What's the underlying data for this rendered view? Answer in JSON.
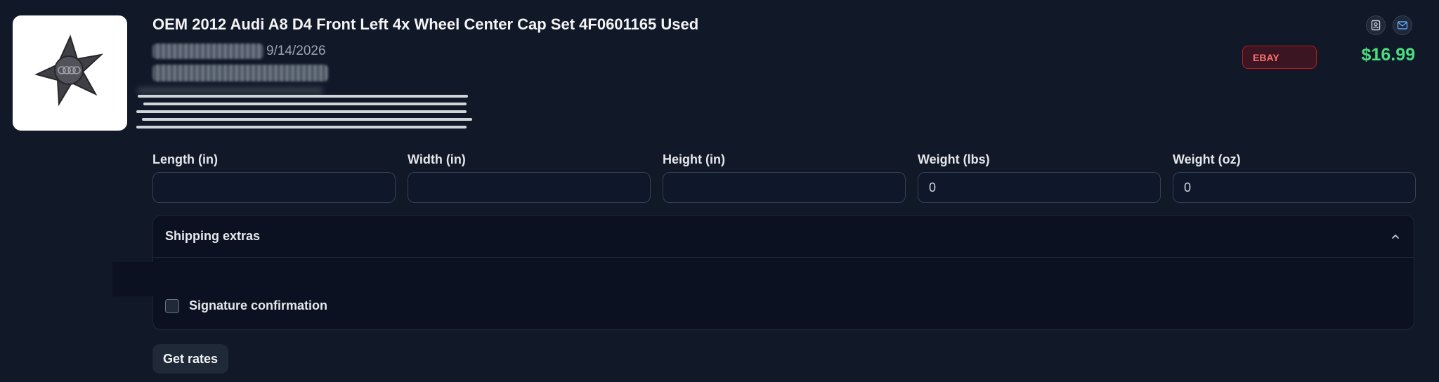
{
  "listing": {
    "title": "OEM 2012 Audi A8 D4 Front Left 4x Wheel Center Cap Set 4F0601165 Used",
    "date": "9/14/2026",
    "marketplace_badge": "EBAY",
    "price": "$16.99",
    "image_icon": "wheel-center-cap-image"
  },
  "actions": {
    "icons": [
      "contact-card-icon",
      "mail-icon"
    ]
  },
  "dimensions": {
    "length_label": "Length (in)",
    "length_value": "",
    "width_label": "Width (in)",
    "width_value": "",
    "height_label": "Height (in)",
    "height_value": "",
    "weight_lbs_label": "Weight (lbs)",
    "weight_lbs_value": "0",
    "weight_oz_label": "Weight (oz)",
    "weight_oz_value": "0"
  },
  "shipping_extras": {
    "title": "Shipping extras",
    "expanded": true,
    "signature_label": "Signature confirmation",
    "signature_checked": false
  },
  "buttons": {
    "get_rates": "Get rates"
  },
  "colors": {
    "background": "#111827",
    "price": "#4ade80",
    "badge_border": "#b91c1c",
    "badge_text": "#f87171"
  }
}
